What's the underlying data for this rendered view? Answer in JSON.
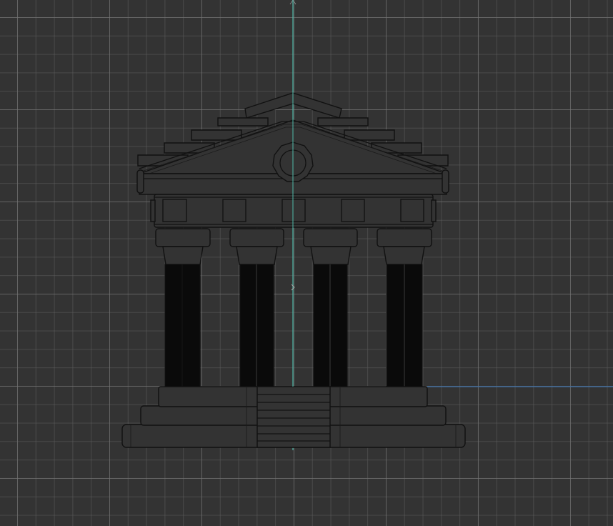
{
  "viewport": {
    "colors": {
      "background": "#333333",
      "axis_vertical": "#4fb8a8",
      "axis_horizontal": "#3b6fa8",
      "wireframe": "#111111"
    },
    "model_icon": "temple-wireframe"
  }
}
